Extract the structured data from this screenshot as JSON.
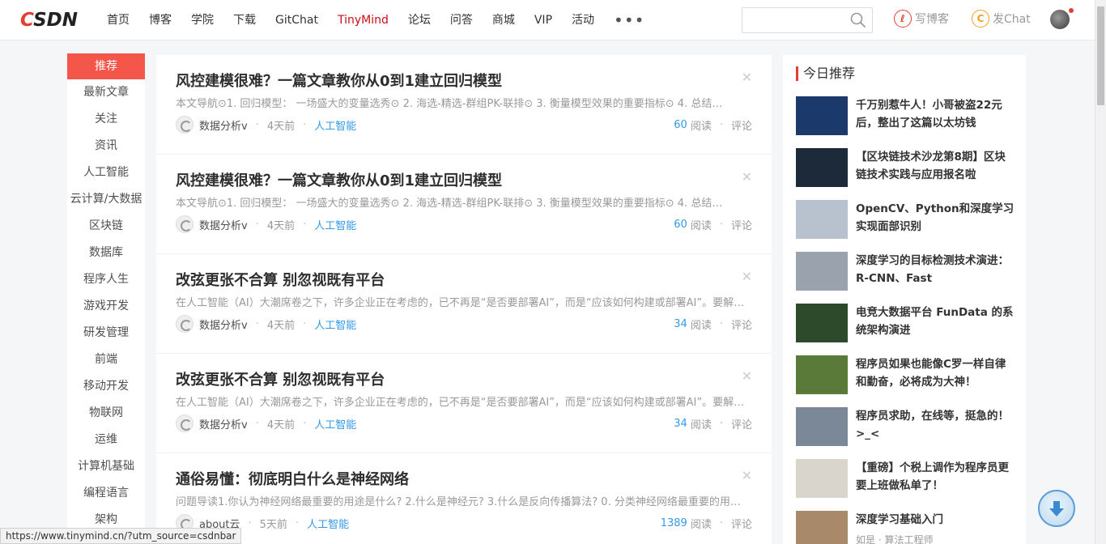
{
  "logo": "CSDN",
  "nav": [
    "首页",
    "博客",
    "学院",
    "下载",
    "GitChat",
    "TinyMind",
    "论坛",
    "问答",
    "商城",
    "VIP",
    "活动"
  ],
  "nav_active_index": 5,
  "nav_more": "•••",
  "search": {
    "value": "",
    "placeholder": ""
  },
  "toolbar": {
    "write_label": "写博客",
    "chat_label": "发Chat"
  },
  "sidebar": [
    "推荐",
    "最新文章",
    "关注",
    "资讯",
    "人工智能",
    "云计算/大数据",
    "区块链",
    "数据库",
    "程序人生",
    "游戏开发",
    "研发管理",
    "前端",
    "移动开发",
    "物联网",
    "运维",
    "计算机基础",
    "编程语言",
    "架构"
  ],
  "feed": [
    {
      "title": "风控建模很难？一篇文章教你从0到1建立回归模型",
      "summary": "本文导航⊙1. 回归模型： 一场盛大的变量选秀⊙ 2. 海选-精选-群组PK-联排⊙ 3. 衡量模型效果的重要指标⊙ 4. 总结…",
      "author": "数据分析v",
      "time": "4天前",
      "tag": "人工智能",
      "reads": "60",
      "read_label": "阅读",
      "comment_label": "评论"
    },
    {
      "title": "风控建模很难？一篇文章教你从0到1建立回归模型",
      "summary": "本文导航⊙1. 回归模型： 一场盛大的变量选秀⊙ 2. 海选-精选-群组PK-联排⊙ 3. 衡量模型效果的重要指标⊙ 4. 总结…",
      "author": "数据分析v",
      "time": "4天前",
      "tag": "人工智能",
      "reads": "60",
      "read_label": "阅读",
      "comment_label": "评论"
    },
    {
      "title": "改弦更张不合算 别忽视既有平台",
      "summary": "在人工智能（AI）大潮席卷之下，许多企业正在考虑的，已不再是“是否要部署AI”，而是“应该如何构建或部署AI”。要解答…",
      "author": "数据分析v",
      "time": "4天前",
      "tag": "人工智能",
      "reads": "34",
      "read_label": "阅读",
      "comment_label": "评论"
    },
    {
      "title": "改弦更张不合算 别忽视既有平台",
      "summary": "在人工智能（AI）大潮席卷之下，许多企业正在考虑的，已不再是“是否要部署AI”，而是“应该如何构建或部署AI”。要解答…",
      "author": "数据分析v",
      "time": "4天前",
      "tag": "人工智能",
      "reads": "34",
      "read_label": "阅读",
      "comment_label": "评论"
    },
    {
      "title": "通俗易懂：彻底明白什么是神经网络",
      "summary": "问题导读1.你认为神经网络最重要的用途是什么? 2.什么是神经元? 3.什么是反向传播算法? 0. 分类神经网络最重要的用途…",
      "author": "about云",
      "time": "5天前",
      "tag": "人工智能",
      "reads": "1389",
      "read_label": "阅读",
      "comment_label": "评论"
    }
  ],
  "right": {
    "title": "今日推荐",
    "items": [
      {
        "text": "千万别惹牛人！小哥被盗22元后，整出了这篇以太坊钱",
        "thumb": "#1b3a6b"
      },
      {
        "text": "【区块链技术沙龙第8期】区块链技术实践与应用报名啦",
        "thumb": "#1d2a3a"
      },
      {
        "text": "OpenCV、Python和深度学习实现面部识别",
        "thumb": "#b8c2cf"
      },
      {
        "text": "深度学习的目标检测技术演进：R-CNN、Fast",
        "thumb": "#9aa3ad"
      },
      {
        "text": "电竞大数据平台 FunData 的系统架构演进",
        "thumb": "#2d4a2a"
      },
      {
        "text": "程序员如果也能像C罗一样自律和勤奋，必将成为大神！",
        "thumb": "#5a7a3a"
      },
      {
        "text": "程序员求助，在线等，挺急的！>_<",
        "thumb": "#7a8898"
      },
      {
        "text": "【重磅】个税上调作为程序员更要上班做私单了！",
        "thumb": "#d9d4cc"
      },
      {
        "text": "深度学习基础入门",
        "thumb": "#a88a6a"
      }
    ],
    "last_sub": "如是 · 算法工程师"
  },
  "status_url": "https://www.tinymind.cn/?utm_source=csdnbar",
  "colors": {
    "brand": "#e33e33",
    "link": "#3399ea",
    "active_nav": "#ca0c16"
  }
}
